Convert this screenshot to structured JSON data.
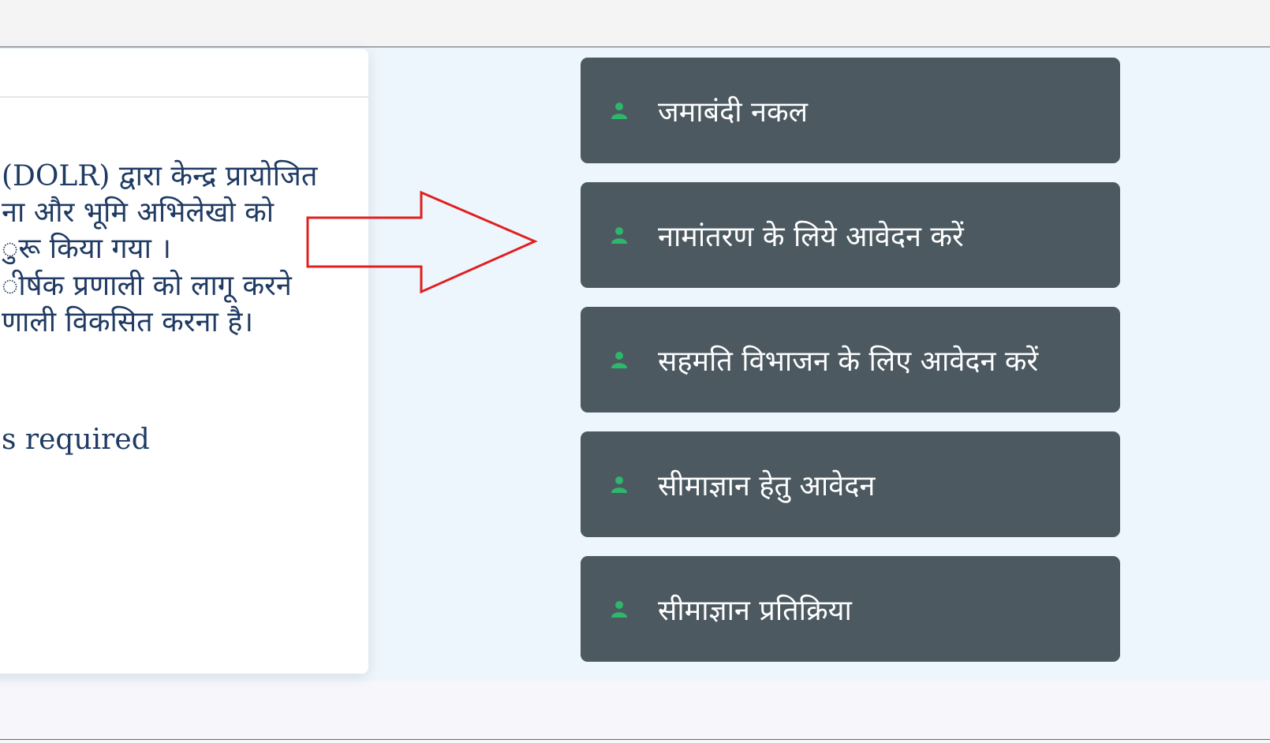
{
  "intro": {
    "lines": [
      "(DOLR) द्वारा केन्द्र प्रायोजित",
      "ना और भूमि अभिलेखो को",
      "ुरू किया गया ।",
      "ीर्षक प्रणाली को लागू करने",
      "णाली विकसित करना है।"
    ],
    "required_text": "s required"
  },
  "menu": {
    "icon": "user-icon",
    "icon_color": "#2eb66b",
    "items": [
      {
        "label": "जमाबंदी नकल"
      },
      {
        "label": "नामांतरण के लिये आवेदन करें"
      },
      {
        "label": "सहमति विभाजन के लिए आवेदन करें"
      },
      {
        "label": "सीमाज्ञान हेतु आवेदन"
      },
      {
        "label": "सीमाज्ञान प्रतिक्रिया"
      }
    ]
  },
  "annotation": {
    "arrow_color": "#e02020"
  }
}
